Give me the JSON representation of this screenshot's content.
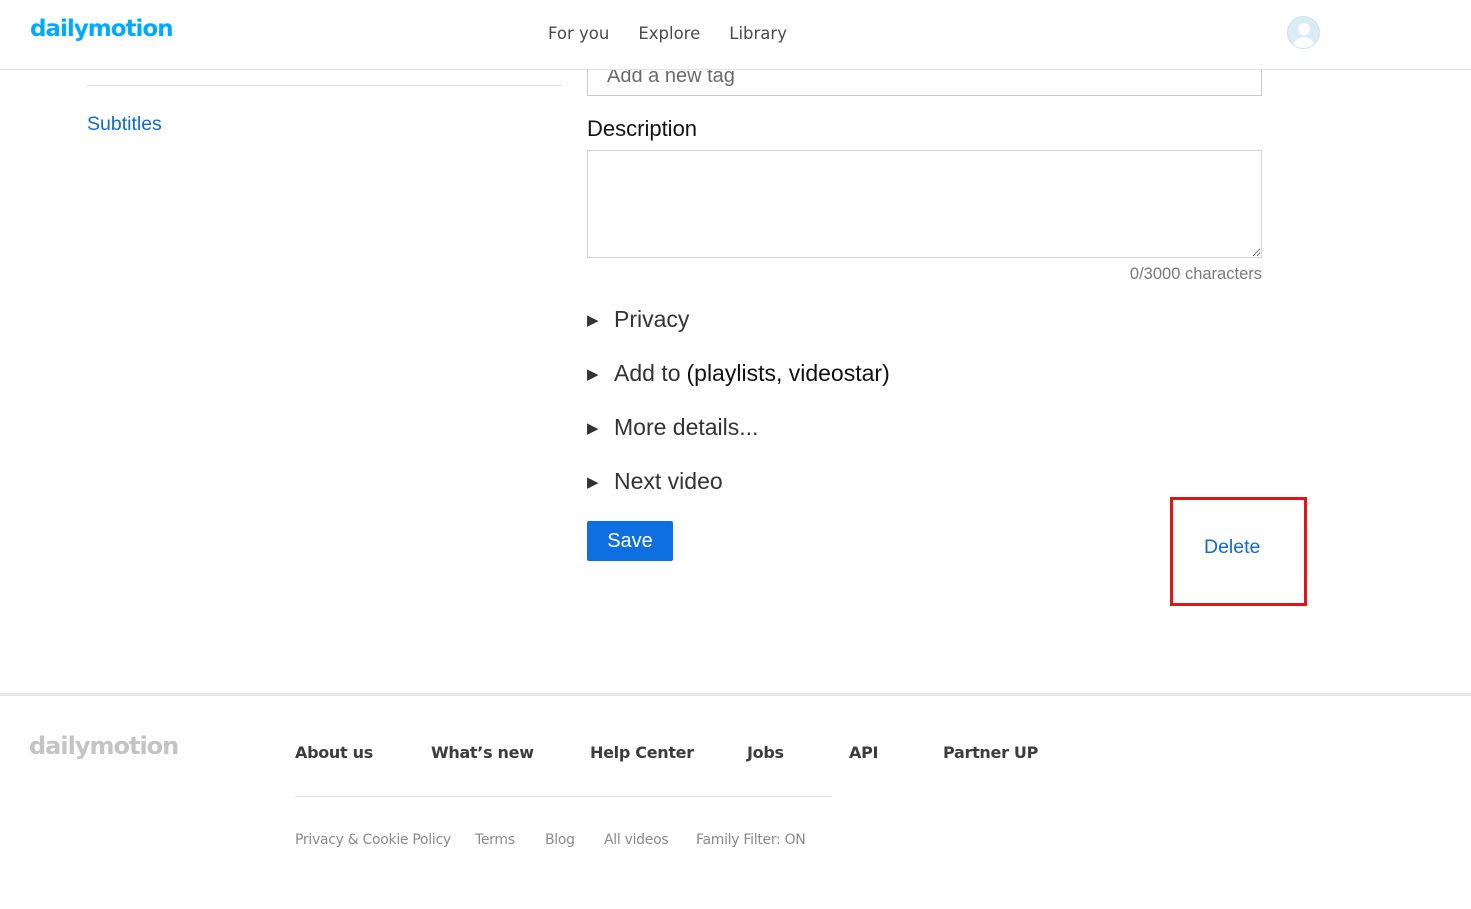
{
  "colors": {
    "brand_blue": "#00aaff",
    "link_blue": "#0d6dc7",
    "save_button_bg": "#0d6fe0",
    "highlight_border": "#e0141c"
  },
  "header": {
    "logo": "dailymotion",
    "nav": [
      "For you",
      "Explore",
      "Library"
    ],
    "avatar_icon": "user-avatar-icon"
  },
  "sidebar": {
    "subtitles_link": "Subtitles"
  },
  "form": {
    "tag_placeholder": "Add a new tag",
    "description_label": "Description",
    "description_value": "",
    "char_count": "0/3000 characters",
    "sections": [
      {
        "label": "Privacy",
        "extra": ""
      },
      {
        "label": "Add to",
        "extra": "(playlists, videostar)"
      },
      {
        "label": "More details...",
        "extra": ""
      },
      {
        "label": "Next video",
        "extra": ""
      }
    ],
    "expand_icon": "triangle-right-icon",
    "save_label": "Save",
    "delete_label": "Delete"
  },
  "footer": {
    "logo": "dailymotion",
    "main_links": [
      "About us",
      "What’s new",
      "Help Center",
      "Jobs",
      "API",
      "Partner UP"
    ],
    "sub_links": [
      "Privacy & Cookie Policy",
      "Terms",
      "Blog",
      "All videos",
      "Family Filter: ON"
    ]
  }
}
